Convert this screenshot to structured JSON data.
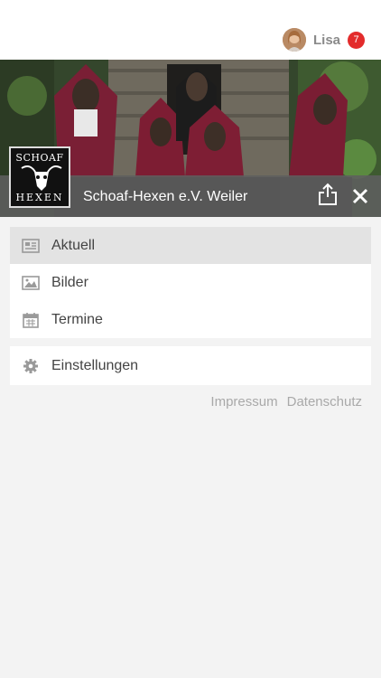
{
  "user": {
    "name": "Lisa",
    "notification_count": "7"
  },
  "club": {
    "title": "Schoaf-Hexen e.V. Weiler",
    "logo_text_top": "SCHOAF",
    "logo_text_bottom": "HEXEN"
  },
  "menu": {
    "primary": [
      {
        "label": "Aktuell",
        "icon": "newspaper-icon",
        "active": true
      },
      {
        "label": "Bilder",
        "icon": "image-icon",
        "active": false
      },
      {
        "label": "Termine",
        "icon": "calendar-icon",
        "active": false
      }
    ],
    "secondary": [
      {
        "label": "Einstellungen",
        "icon": "gear-icon"
      }
    ]
  },
  "footer": {
    "impressum": "Impressum",
    "datenschutz": "Datenschutz"
  },
  "colors": {
    "badge": "#e32b2b",
    "caption_bar": "#5f5f5f",
    "active_item": "#e3e3e3",
    "icon": "#9a9a9a"
  }
}
